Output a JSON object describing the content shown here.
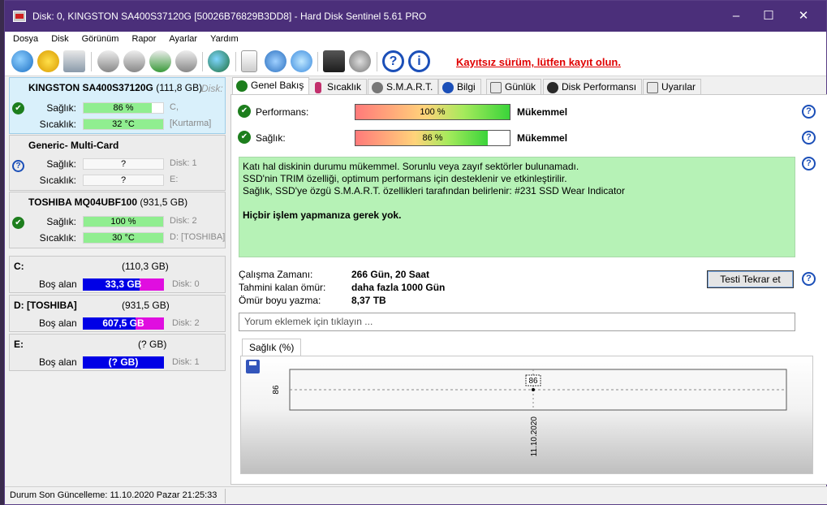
{
  "window": {
    "title": "Disk: 0, KINGSTON SA400S37120G [50026B76829B3DD8]  -  Hard Disk Sentinel 5.61 PRO",
    "controls": {
      "minimize": "–",
      "maximize": "☐",
      "close": "✕"
    }
  },
  "menu": [
    "Dosya",
    "Disk",
    "Görünüm",
    "Rapor",
    "Ayarlar",
    "Yardım"
  ],
  "toolbar": {
    "icons": [
      "refresh-icon",
      "alert-icon",
      "drive-icon",
      "disk-tool-icon",
      "disk-info-icon",
      "disk-check-icon",
      "disk-scan-icon",
      "globe-icon",
      "report-icon",
      "sync-icon",
      "network-icon",
      "monitor-icon",
      "sound-icon",
      "help-icon",
      "info-icon"
    ],
    "unregistered": "Kayıtsız sürüm, lütfen kayıt olun."
  },
  "disks": [
    {
      "name": "KINGSTON SA400S37120G",
      "size": "(111,8 GB)",
      "disk_label": "Disk:",
      "status_icon": "check-icon",
      "health_label": "Sağlık:",
      "health": "86 %",
      "health_pct": 86,
      "health_aside": "C,",
      "temp_label": "Sıcaklık:",
      "temp": "32 °C",
      "temp_pct": 100,
      "temp_aside": "[Kurtarma]"
    },
    {
      "name": "Generic- Multi-Card",
      "size": "",
      "disk_label": "",
      "status_icon": "question-icon",
      "health_label": "Sağlık:",
      "health": "?",
      "health_pct": 0,
      "health_aside": "Disk: 1",
      "temp_label": "Sıcaklık:",
      "temp": "?",
      "temp_pct": 0,
      "temp_aside": "E:"
    },
    {
      "name": "TOSHIBA MQ04UBF100",
      "size": "(931,5 GB)",
      "disk_label": "",
      "status_icon": "check-icon",
      "health_label": "Sağlık:",
      "health": "100 %",
      "health_pct": 100,
      "health_aside": "Disk: 2",
      "temp_label": "Sıcaklık:",
      "temp": "30 °C",
      "temp_pct": 100,
      "temp_aside": "D: [TOSHIBA]"
    }
  ],
  "volumes": [
    {
      "name": "C:",
      "size": "(110,3 GB)",
      "free_label": "Boş alan",
      "free": "33,3 GB",
      "used_pct": 30,
      "aside": "Disk: 0"
    },
    {
      "name": "D: [TOSHIBA]",
      "size": "(931,5 GB)",
      "free_label": "Boş alan",
      "free": "607,5 GB",
      "used_pct": 35,
      "aside": "Disk: 2"
    },
    {
      "name": "E:",
      "size": "(? GB)",
      "free_label": "Boş alan",
      "free": "(? GB)",
      "used_pct": 0,
      "aside": "Disk: 1"
    }
  ],
  "tabs": [
    {
      "label": "Genel Bakış",
      "icon": "check-circle-icon"
    },
    {
      "label": "Sıcaklık",
      "icon": "thermometer-icon"
    },
    {
      "label": "S.M.A.R.T.",
      "icon": "smart-icon"
    },
    {
      "label": "Bilgi",
      "icon": "info-icon"
    },
    {
      "label": "Günlük",
      "icon": "log-icon"
    },
    {
      "label": "Disk Performansı",
      "icon": "performance-icon"
    },
    {
      "label": "Uyarılar",
      "icon": "alerts-icon"
    }
  ],
  "overview": {
    "performance_label": "Performans:",
    "performance": "100 %",
    "performance_pct": 100,
    "performance_rating": "Mükemmel",
    "health_label": "Sağlık:",
    "health": "86 %",
    "health_pct": 86,
    "health_rating": "Mükemmel",
    "summary": [
      "Katı hal diskinin durumu mükemmel. Sorunlu veya zayıf sektörler bulunamadı.",
      "SSD'nin TRIM özelliği, optimum performans için desteklenir ve etkinleştirilir.",
      "Sağlık, SSD'ye özgü S.M.A.R.T. özellikleri tarafından belirlenir: #231 SSD Wear Indicator"
    ],
    "summary_bold": "Hiçbir işlem yapmanıza gerek yok.",
    "power_on_label": "Çalışma Zamanı:",
    "power_on": "266 Gün, 20 Saat",
    "remaining_label": "Tahmini kalan ömür:",
    "remaining": "daha fazla 1000 Gün",
    "written_label": "Ömür boyu yazma:",
    "written": "8,37 TB",
    "retest_button": "Testi Tekrar et",
    "comment_placeholder": "Yorum eklemek için tıklayın ..."
  },
  "chart_tab": "Sağlık (%)",
  "chart_data": {
    "type": "line",
    "x": [
      "11.10.2020"
    ],
    "series": [
      {
        "values": [
          86
        ]
      }
    ],
    "ytick": "86",
    "data_label": "86",
    "xlabel": "",
    "ylabel": "",
    "grid": true
  },
  "status": {
    "text": "Durum Son Güncelleme: 11.10.2020 Pazar 21:25:33"
  },
  "colors": {
    "titlebar": "#4b2f7a",
    "health_bar": "#90ee90",
    "free_bar": "#0000e6",
    "used_bar": "#e00ee0",
    "summary_bg": "#b6f2b6",
    "unregistered": "#e00000"
  }
}
